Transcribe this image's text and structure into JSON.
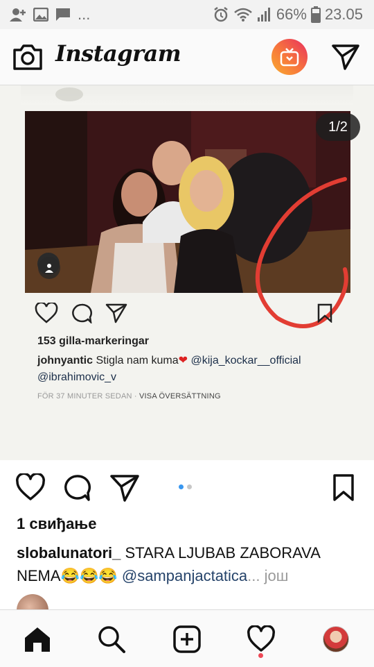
{
  "status_bar": {
    "more_indicator": "...",
    "battery_percent": "66%",
    "time": "23.05",
    "icons": [
      "add-contact-icon",
      "image-icon",
      "message-icon",
      "alarm-icon",
      "wifi-icon",
      "signal-icon",
      "battery-icon"
    ]
  },
  "app_bar": {
    "title": "Instagram",
    "icons": [
      "camera-icon",
      "igtv-icon",
      "direct-send-icon"
    ],
    "igtv_gradient": [
      "#f9ad2f",
      "#f7783c",
      "#e8305f"
    ]
  },
  "post": {
    "page_counter": "1/2",
    "embedded_screenshot": {
      "likes": "153 gilla-markeringar",
      "username": "johnyantic",
      "caption": " Stigla nam kuma",
      "heart_emoji": "❤",
      "mention_1": " @kija_kockar__official",
      "mention_2": "@ibrahimovic_v",
      "time_text": "FÖR 37 MINUTER SEDAN · ",
      "translate_text": "VISA ÖVERSÄTTNING"
    },
    "carousel": {
      "count": 2,
      "active_index": 0,
      "active_color": "#3897f0",
      "inactive_color": "#c7c7c7"
    },
    "likes_text": "1 свиђање",
    "username": "slobalunatori_",
    "caption_text": " STARA LJUBAB ZABORAVA NEMA",
    "caption_emojis": "😂😂😂",
    "caption_mention": " @sampanjactatica",
    "more_text": "... још"
  },
  "bottom_nav": {
    "items": [
      "home-icon",
      "search-icon",
      "new-post-icon",
      "activity-icon",
      "profile-avatar"
    ],
    "notification_dot_color": "#ed4956"
  }
}
